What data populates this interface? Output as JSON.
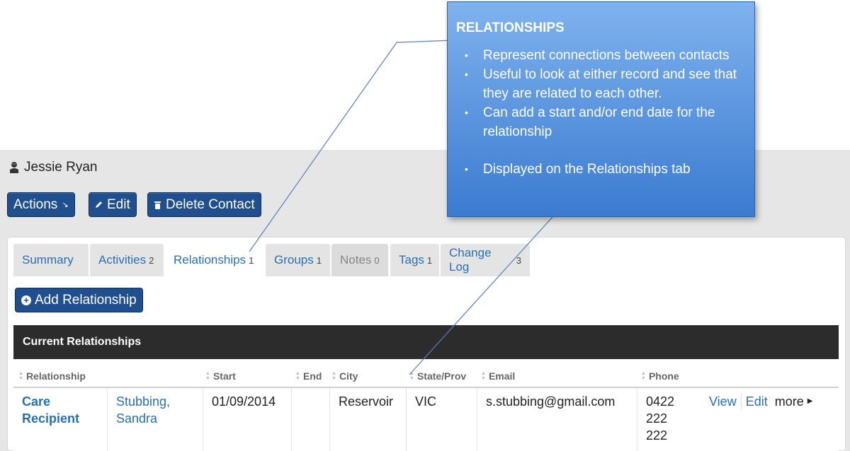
{
  "contact": {
    "name": "Jessie Ryan",
    "icon": "contact-icon"
  },
  "toolbar": {
    "actions_label": "Actions",
    "actions_caret": "↘",
    "edit_label": "Edit",
    "delete_label": "Delete Contact"
  },
  "tabs": [
    {
      "label": "Summary",
      "count": ""
    },
    {
      "label": "Activities",
      "count": "2"
    },
    {
      "label": "Relationships",
      "count": "1"
    },
    {
      "label": "Groups",
      "count": "1"
    },
    {
      "label": "Notes",
      "count": "0"
    },
    {
      "label": "Tags",
      "count": "1"
    },
    {
      "label": "Change Log",
      "count": "3"
    }
  ],
  "add_relationship_label": "Add Relationship",
  "table": {
    "title": "Current Relationships",
    "headers": [
      "Relationship",
      "Start",
      "End",
      "City",
      "State/Prov",
      "Email",
      "Phone"
    ],
    "rows": [
      {
        "relationship_line1": "Care",
        "relationship_line2": "Recipient",
        "contact_line1": "Stubbing,",
        "contact_line2": "Sandra",
        "start": "01/09/2014",
        "end": "",
        "city": "Reservoir",
        "state": "VIC",
        "email": "s.stubbing@gmail.com",
        "phone_line1": "0422",
        "phone_line2": "222",
        "phone_line3": "222",
        "view_label": "View",
        "edit_label": "Edit",
        "more_label": "more"
      }
    ]
  },
  "callout": {
    "title": "RELATIONSHIPS",
    "bullets": [
      "Represent connections between contacts",
      "Useful to look at either record and see that they are related to each other.",
      "Can add a start and/or end date for the relationship",
      "Displayed on the Relationships tab"
    ]
  },
  "colors": {
    "primary_button": "#1f4f8f",
    "link": "#2a6fb0",
    "table_title_bg": "#2c2c2c",
    "callout_top": "#7fb2ee",
    "callout_bottom": "#3b7bd0"
  }
}
